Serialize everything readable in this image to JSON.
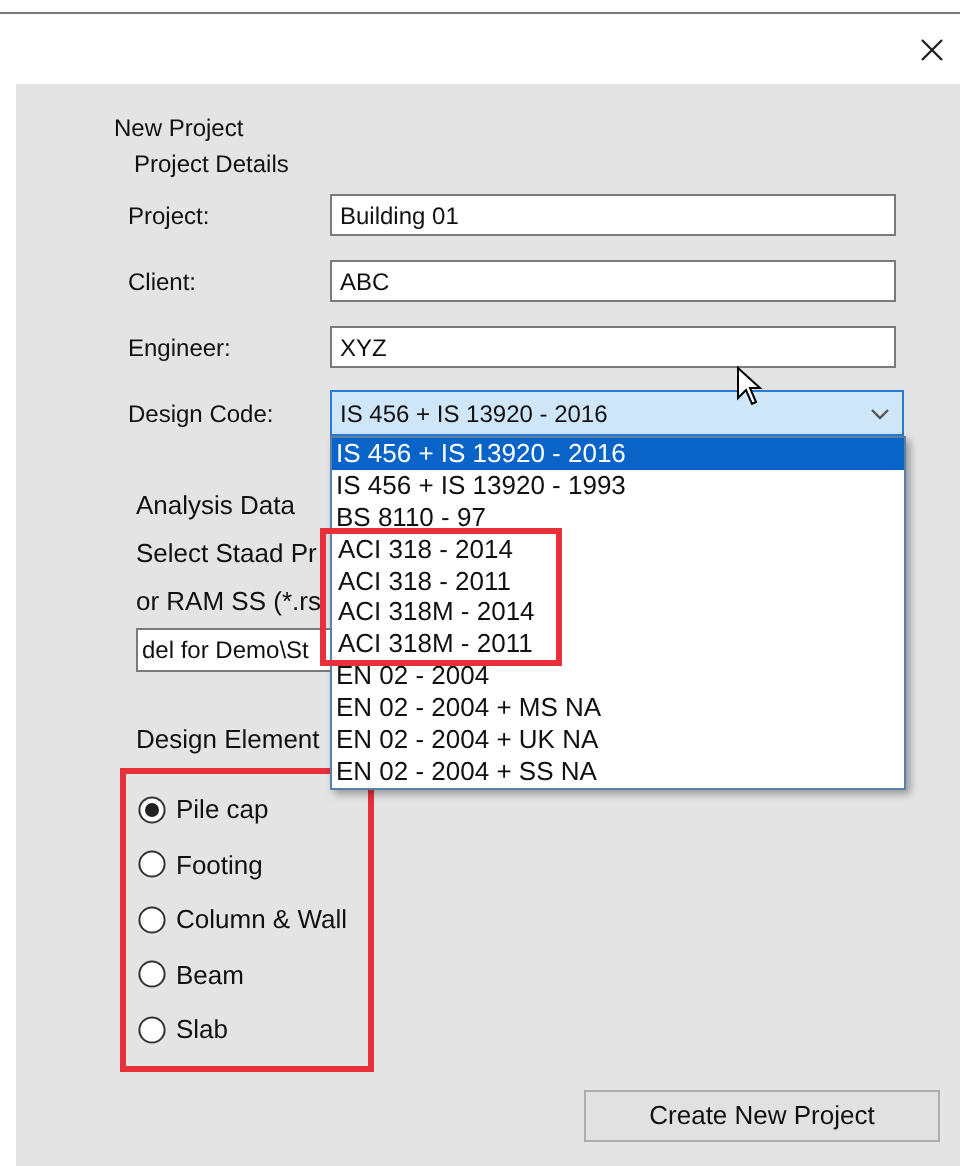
{
  "dialog": {
    "title": "New Project"
  },
  "project_details": {
    "title": "Project Details",
    "fields": [
      {
        "label": "Project:",
        "value": "Building 01"
      },
      {
        "label": "Client:",
        "value": "ABC"
      },
      {
        "label": "Engineer:",
        "value": "XYZ"
      }
    ],
    "design_code": {
      "label": "Design Code:",
      "value": "IS 456 + IS 13920 - 2016",
      "expanded": true,
      "options": [
        {
          "text": "IS 456 + IS 13920 - 2016",
          "selected": true,
          "highlighted": false
        },
        {
          "text": "IS 456 + IS 13920 - 1993",
          "selected": false,
          "highlighted": false
        },
        {
          "text": "BS 8110 - 97",
          "selected": false,
          "highlighted": false
        },
        {
          "text": "ACI 318 - 2014",
          "selected": false,
          "highlighted": true
        },
        {
          "text": "ACI 318 - 2011",
          "selected": false,
          "highlighted": true
        },
        {
          "text": "ACI 318M - 2014",
          "selected": false,
          "highlighted": true
        },
        {
          "text": "ACI 318M - 2011",
          "selected": false,
          "highlighted": true
        },
        {
          "text": "EN 02 - 2004",
          "selected": false,
          "highlighted": false
        },
        {
          "text": "EN 02 - 2004 + MS NA",
          "selected": false,
          "highlighted": false
        },
        {
          "text": "EN 02 - 2004 + UK NA",
          "selected": false,
          "highlighted": false
        },
        {
          "text": "EN 02 - 2004 + SS NA",
          "selected": false,
          "highlighted": false
        }
      ]
    }
  },
  "analysis_data": {
    "title": "Analysis Data",
    "prompt_lines": [
      "Select Staad Pr",
      "or RAM SS (*.rs"
    ],
    "file_path": "del for Demo\\St"
  },
  "design_element": {
    "title": "Design Element",
    "highlighted": true,
    "options": [
      {
        "label": "Pile cap",
        "selected": true
      },
      {
        "label": "Footing",
        "selected": false
      },
      {
        "label": "Column & Wall",
        "selected": false
      },
      {
        "label": "Beam",
        "selected": false
      },
      {
        "label": "Slab",
        "selected": false
      }
    ]
  },
  "create_button": "Create New Project"
}
